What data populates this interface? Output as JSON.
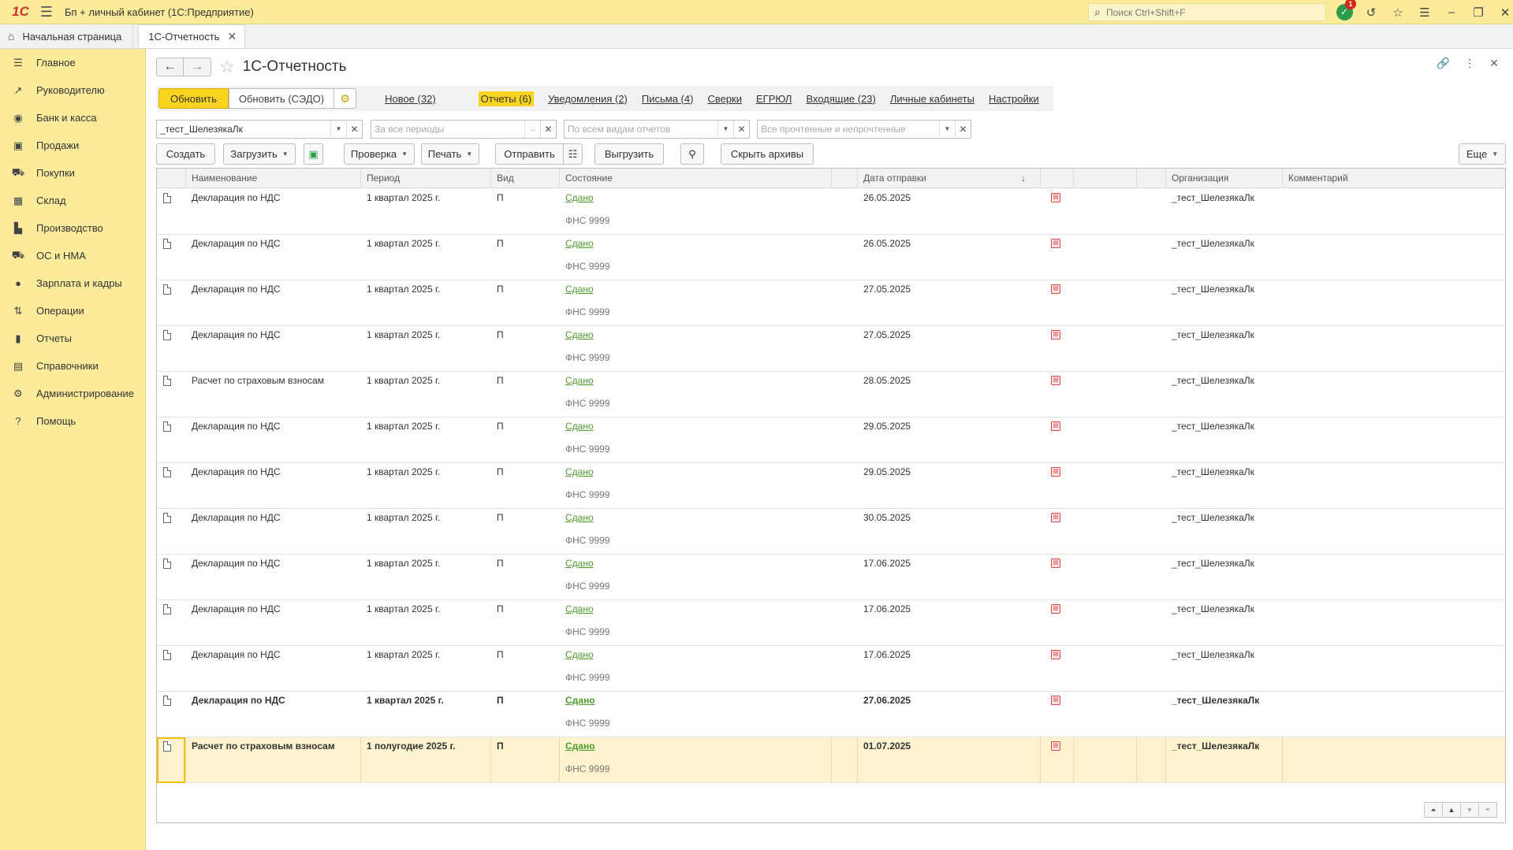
{
  "app": {
    "logo_text": "1C",
    "title": "Бп + личный кабинет  (1С:Предприятие)",
    "search_placeholder": "Поиск Ctrl+Shift+F",
    "notification_count": "1"
  },
  "tabs": {
    "home": "Начальная страница",
    "active": "1С-Отчетность"
  },
  "sidebar": {
    "items": [
      {
        "label": "Главное",
        "icon": "menu-icon"
      },
      {
        "label": "Руководителю",
        "icon": "trend-icon"
      },
      {
        "label": "Банк и касса",
        "icon": "coins-icon"
      },
      {
        "label": "Продажи",
        "icon": "bag-icon"
      },
      {
        "label": "Покупки",
        "icon": "cart-icon"
      },
      {
        "label": "Склад",
        "icon": "warehouse-icon"
      },
      {
        "label": "Производство",
        "icon": "factory-icon"
      },
      {
        "label": "ОС и НМА",
        "icon": "truck-icon"
      },
      {
        "label": "Зарплата и кадры",
        "icon": "person-icon"
      },
      {
        "label": "Операции",
        "icon": "operations-icon"
      },
      {
        "label": "Отчеты",
        "icon": "chart-icon"
      },
      {
        "label": "Справочники",
        "icon": "books-icon"
      },
      {
        "label": "Администрирование",
        "icon": "gear-icon"
      },
      {
        "label": "Помощь",
        "icon": "help-icon"
      }
    ]
  },
  "form": {
    "title": "1С-Отчетность"
  },
  "toolbar1": {
    "update": "Обновить",
    "update_sedo": "Обновить (СЭДО)",
    "sections": {
      "new": "Новое (32)",
      "reports": "Отчеты (6)",
      "notifications": "Уведомления (2)",
      "letters": "Письма (4)",
      "reconciliations": "Сверки",
      "egrul": "ЕГРЮЛ",
      "incoming": "Входящие (23)",
      "cabinets": "Личные кабинеты",
      "settings": "Настройки"
    }
  },
  "filters": {
    "organization": "_тест_ШелезякаЛк",
    "period_placeholder": "За все периоды",
    "type_placeholder": "По всем видам отчетов",
    "read_placeholder": "Все прочтенные и непрочтенные"
  },
  "toolbar2": {
    "create": "Создать",
    "load": "Загрузить",
    "check": "Проверка",
    "print": "Печать",
    "send": "Отправить",
    "export": "Выгрузить",
    "hide_archives": "Скрыть архивы",
    "more": "Еще"
  },
  "table": {
    "columns": {
      "name": "Наименование",
      "period": "Период",
      "kind": "Вид",
      "state": "Состояние",
      "sent_date": "Дата отправки",
      "sort_indicator": "↓",
      "organization": "Организация",
      "comment": "Комментарий"
    },
    "rows": [
      {
        "name": "Декларация по НДС",
        "period": "1 квартал 2025 г.",
        "kind": "П",
        "state": "Сдано",
        "authority": "ФНС 9999",
        "date": "26.05.2025",
        "org": "_тест_ШелезякаЛк"
      },
      {
        "name": "Декларация по НДС",
        "period": "1 квартал 2025 г.",
        "kind": "П",
        "state": "Сдано",
        "authority": "ФНС 9999",
        "date": "26.05.2025",
        "org": "_тест_ШелезякаЛк"
      },
      {
        "name": "Декларация по НДС",
        "period": "1 квартал 2025 г.",
        "kind": "П",
        "state": "Сдано",
        "authority": "ФНС 9999",
        "date": "27.05.2025",
        "org": "_тест_ШелезякаЛк"
      },
      {
        "name": "Декларация по НДС",
        "period": "1 квартал 2025 г.",
        "kind": "П",
        "state": "Сдано",
        "authority": "ФНС 9999",
        "date": "27.05.2025",
        "org": "_тест_ШелезякаЛк"
      },
      {
        "name": "Расчет по страховым взносам",
        "period": "1 квартал 2025 г.",
        "kind": "П",
        "state": "Сдано",
        "authority": "ФНС 9999",
        "date": "28.05.2025",
        "org": "_тест_ШелезякаЛк"
      },
      {
        "name": "Декларация по НДС",
        "period": "1 квартал 2025 г.",
        "kind": "П",
        "state": "Сдано",
        "authority": "ФНС 9999",
        "date": "29.05.2025",
        "org": "_тест_ШелезякаЛк"
      },
      {
        "name": "Декларация по НДС",
        "period": "1 квартал 2025 г.",
        "kind": "П",
        "state": "Сдано",
        "authority": "ФНС 9999",
        "date": "29.05.2025",
        "org": "_тест_ШелезякаЛк"
      },
      {
        "name": "Декларация по НДС",
        "period": "1 квартал 2025 г.",
        "kind": "П",
        "state": "Сдано",
        "authority": "ФНС 9999",
        "date": "30.05.2025",
        "org": "_тест_ШелезякаЛк"
      },
      {
        "name": "Декларация по НДС",
        "period": "1 квартал 2025 г.",
        "kind": "П",
        "state": "Сдано",
        "authority": "ФНС 9999",
        "date": "17.06.2025",
        "org": "_тест_ШелезякаЛк"
      },
      {
        "name": "Декларация по НДС",
        "period": "1 квартал 2025 г.",
        "kind": "П",
        "state": "Сдано",
        "authority": "ФНС 9999",
        "date": "17.06.2025",
        "org": "_тест_ШелезякаЛк"
      },
      {
        "name": "Декларация по НДС",
        "period": "1 квартал 2025 г.",
        "kind": "П",
        "state": "Сдано",
        "authority": "ФНС 9999",
        "date": "17.06.2025",
        "org": "_тест_ШелезякаЛк"
      },
      {
        "name": "Декларация по НДС",
        "period": "1 квартал 2025 г.",
        "kind": "П",
        "state": "Сдано",
        "authority": "ФНС 9999",
        "date": "27.06.2025",
        "org": "_тест_ШелезякаЛк",
        "bold": true
      },
      {
        "name": "Расчет по страховым взносам",
        "period": "1 полугодие 2025 г.",
        "kind": "П",
        "state": "Сдано",
        "authority": "ФНС 9999",
        "date": "01.07.2025",
        "org": "_тест_ШелезякаЛк",
        "bold": true,
        "selected": true
      }
    ]
  },
  "colors": {
    "accent_yellow": "#fbd420",
    "panel_yellow": "#fbeb9b",
    "status_green": "#4f9a2d",
    "notification_green": "#2e9b4a",
    "badge_red": "#d9251b"
  }
}
